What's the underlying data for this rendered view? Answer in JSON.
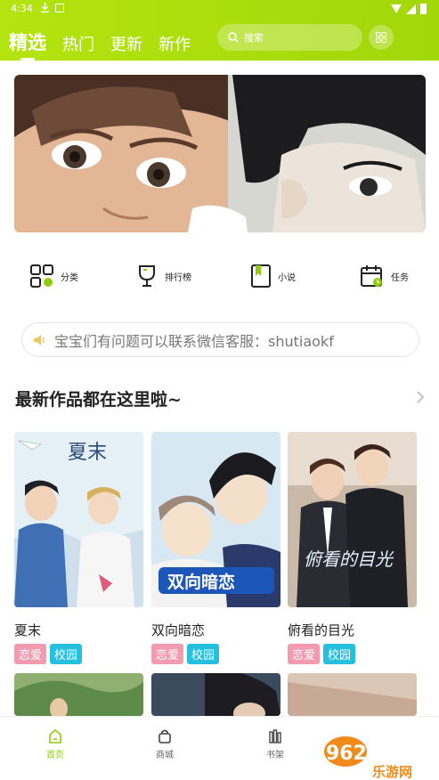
{
  "status": {
    "time": "4:34"
  },
  "header": {
    "tabs": [
      {
        "label": "精选",
        "active": true
      },
      {
        "label": "热门",
        "active": false
      },
      {
        "label": "更新",
        "active": false
      },
      {
        "label": "新作",
        "active": false
      }
    ],
    "search_placeholder": "搜索"
  },
  "quick": [
    {
      "label": "分类",
      "icon": "category-icon"
    },
    {
      "label": "排行榜",
      "icon": "trophy-icon"
    },
    {
      "label": "小说",
      "icon": "book-icon"
    },
    {
      "label": "任务",
      "icon": "calendar-task-icon"
    }
  ],
  "notice": {
    "text": "宝宝们有问题可以联系微信客服：shutiaokf"
  },
  "section": {
    "title": "最新作品都在这里啦~"
  },
  "cards": [
    {
      "title": "夏末",
      "tags": [
        "恋爱",
        "校园"
      ],
      "cover_text": "夏末"
    },
    {
      "title": "双向暗恋",
      "tags": [
        "恋爱",
        "校园"
      ],
      "cover_text": "双向暗恋"
    },
    {
      "title": "俯看的目光",
      "tags": [
        "恋爱",
        "校园"
      ],
      "cover_text": "俯看的目光"
    }
  ],
  "bottom_nav": [
    {
      "label": "首页",
      "active": true
    },
    {
      "label": "商城",
      "active": false
    },
    {
      "label": "书架",
      "active": false
    }
  ],
  "watermark": {
    "text": "962.NET",
    "sub": "乐游网"
  },
  "colors": {
    "brand": "#a6da0c",
    "tag_pink": "#f29ab0",
    "tag_cyan": "#25c0e0"
  }
}
